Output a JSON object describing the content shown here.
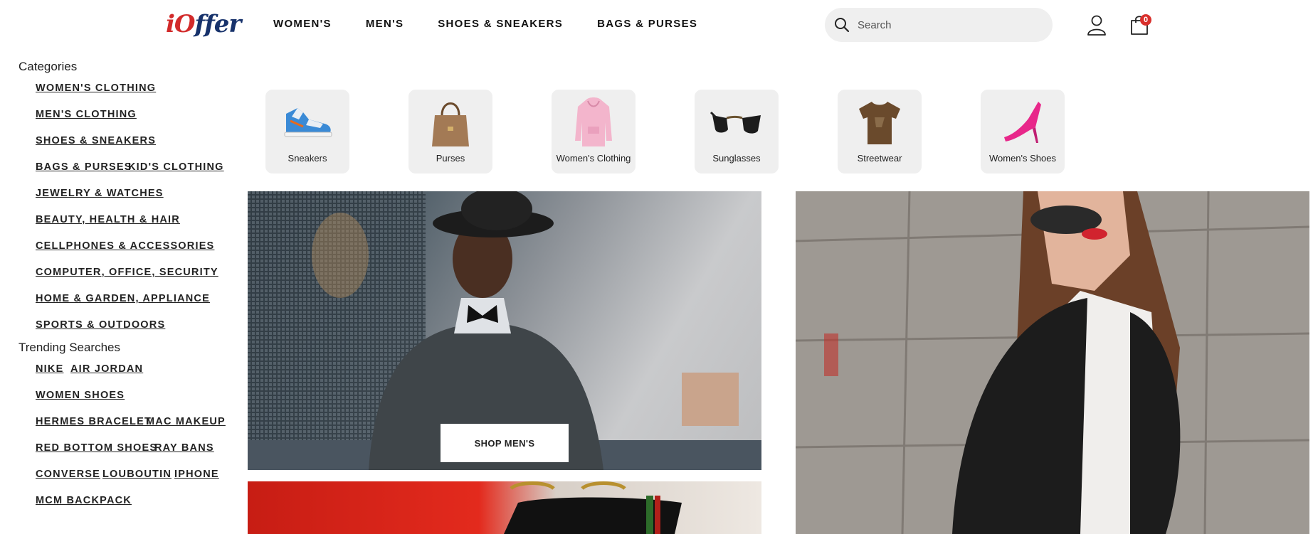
{
  "header": {
    "logo": {
      "part1": "i",
      "part2": "O",
      "part3": "ffer"
    },
    "nav": [
      "WOMEN'S",
      "MEN'S",
      "SHOES & SNEAKERS",
      "BAGS & PURSES"
    ],
    "search_placeholder": "Search",
    "cart_count": "0"
  },
  "sidebar": {
    "categories_title": "Categories",
    "categories": [
      "WOMEN'S CLOTHING",
      "MEN'S CLOTHING",
      "SHOES & SNEAKERS",
      "BAGS & PURSES",
      "KID'S CLOTHING",
      "JEWELRY & WATCHES",
      "BEAUTY, HEALTH & HAIR",
      "CELLPHONES & ACCESSORIES",
      "COMPUTER, OFFICE, SECURITY",
      "HOME & GARDEN, APPLIANCE",
      "SPORTS & OUTDOORS"
    ],
    "trending_title": "Trending Searches",
    "trending": [
      "NIKE",
      "AIR JORDAN",
      "WOMEN SHOES",
      "HERMES BRACELET",
      "MAC MAKEUP",
      "RED BOTTOM SHOES",
      "RAY BANS",
      "CONVERSE",
      "LOUBOUTIN",
      "IPHONE",
      "MCM BACKPACK"
    ]
  },
  "tiles": [
    {
      "label": "Sneakers",
      "icon": "sneaker-icon"
    },
    {
      "label": "Purses",
      "icon": "purse-icon"
    },
    {
      "label": "Women's Clothing",
      "icon": "hoodie-icon"
    },
    {
      "label": "Sunglasses",
      "icon": "sunglasses-icon"
    },
    {
      "label": "Streetwear",
      "icon": "tshirt-icon"
    },
    {
      "label": "Women's Shoes",
      "icon": "heel-icon"
    }
  ],
  "banners": {
    "shop_mens": "SHOP MEN'S"
  },
  "colors": {
    "brand_blue": "#17326b",
    "brand_red": "#d22a2a",
    "badge": "#d9302c",
    "tile_bg": "#efefef"
  }
}
